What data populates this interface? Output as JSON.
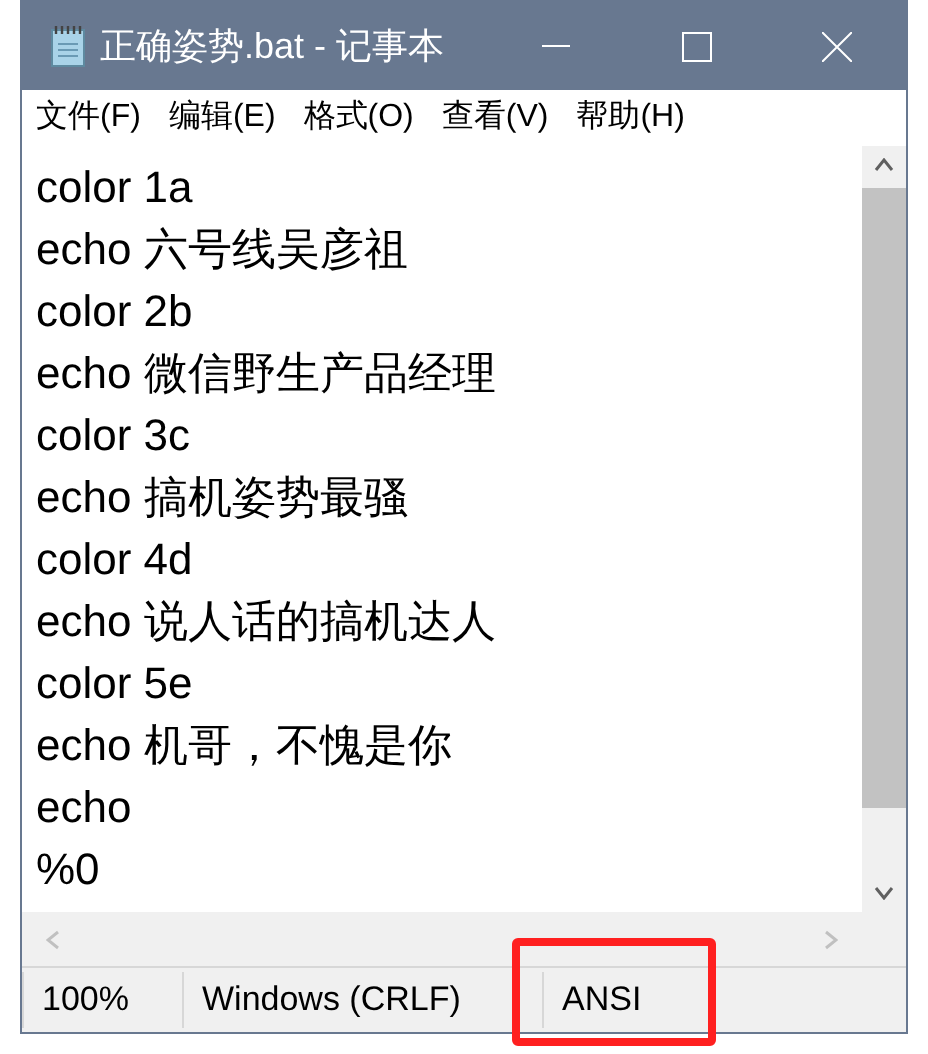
{
  "window": {
    "title": "正确姿势.bat - 记事本"
  },
  "menu": [
    "文件(F)",
    "编辑(E)",
    "格式(O)",
    "查看(V)",
    "帮助(H)"
  ],
  "editor": {
    "lines": [
      "color 1a",
      "echo 六号线吴彦祖",
      "color 2b",
      "echo 微信野生产品经理",
      "color 3c",
      "echo 搞机姿势最骚",
      "color 4d",
      "echo 说人话的搞机达人",
      "color 5e",
      "echo 机哥，不愧是你",
      "echo",
      "%0"
    ]
  },
  "status_bar": [
    "100%",
    "Windows (CRLF)",
    "ANSI"
  ]
}
